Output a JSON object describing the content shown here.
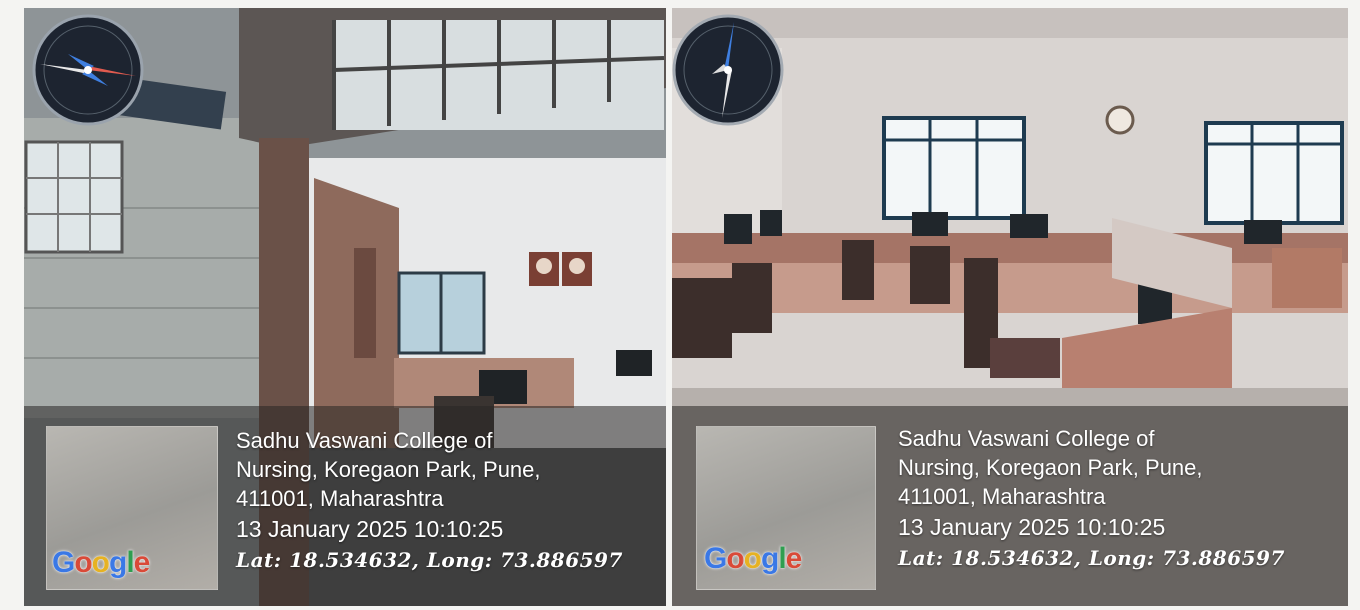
{
  "panels": [
    {
      "address_line1": "Sadhu Vaswani College of",
      "address_line2": "Nursing, Koregaon Park, Pune,",
      "address_line3": "411001, Maharashtra",
      "datetime": "13 January 2025 10:10:25",
      "coordinates": "Lat: 18.534632, Long: 73.886597",
      "logo_text": "Google",
      "icon": "compass-icon"
    },
    {
      "address_line1": "Sadhu Vaswani College of",
      "address_line2": "Nursing, Koregaon Park, Pune,",
      "address_line3": "411001, Maharashtra",
      "datetime": "13 January 2025 10:10:25",
      "coordinates": "Lat: 18.534632, Long: 73.886597",
      "logo_text": "Google",
      "icon": "compass-icon"
    }
  ],
  "colors": {
    "overlay": "#2b2826",
    "google_blue": "#3a78e6",
    "google_red": "#d94a38",
    "google_yellow": "#e6b223",
    "google_green": "#2f9e50"
  }
}
